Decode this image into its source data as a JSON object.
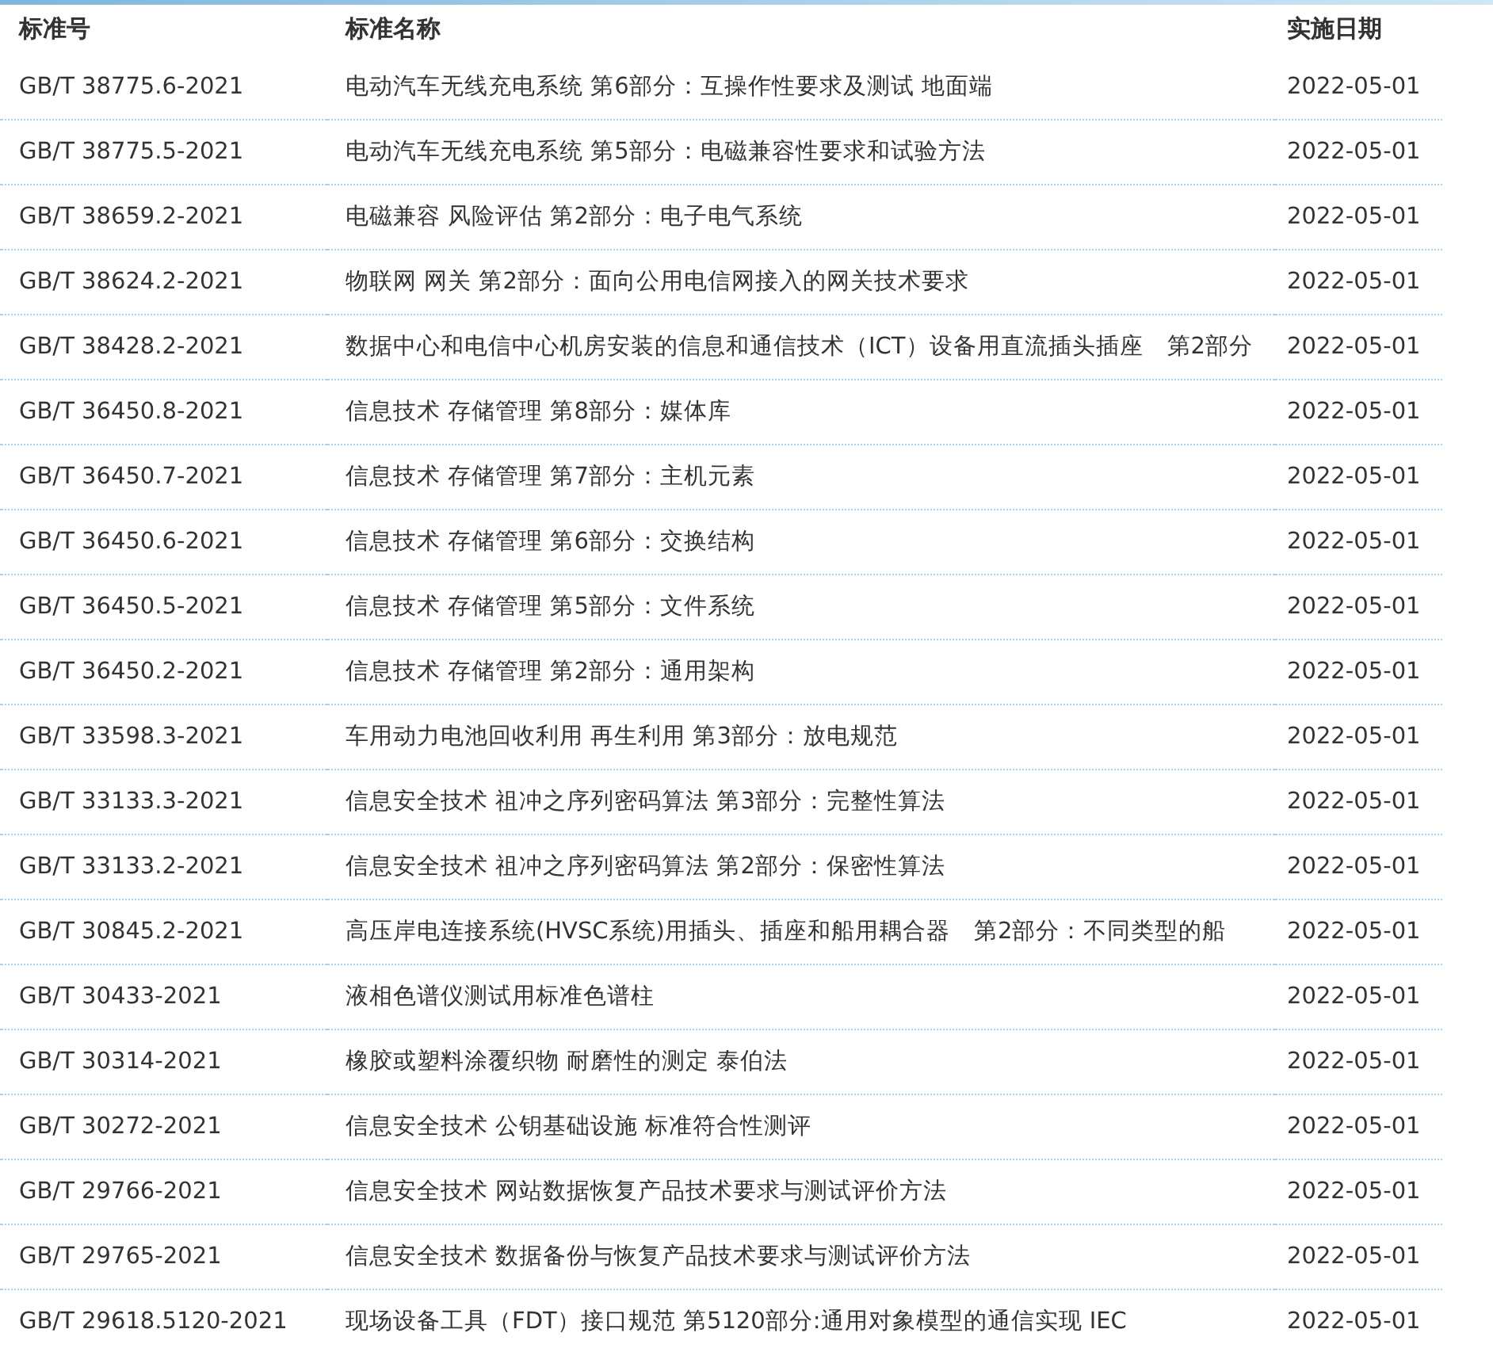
{
  "table": {
    "columns": [
      "标准号",
      "标准名称",
      "实施日期"
    ],
    "rows": [
      [
        "GB/T 38775.6-2021",
        "电动汽车无线充电系统 第6部分：互操作性要求及测试 地面端",
        "2022-05-01"
      ],
      [
        "GB/T 38775.5-2021",
        "电动汽车无线充电系统 第5部分：电磁兼容性要求和试验方法",
        "2022-05-01"
      ],
      [
        "GB/T 38659.2-2021",
        "电磁兼容 风险评估 第2部分：电子电气系统",
        "2022-05-01"
      ],
      [
        "GB/T 38624.2-2021",
        "物联网 网关 第2部分：面向公用电信网接入的网关技术要求",
        "2022-05-01"
      ],
      [
        "GB/T 38428.2-2021",
        "数据中心和电信中心机房安装的信息和通信技术（ICT）设备用直流插头插座　第2部分",
        "2022-05-01"
      ],
      [
        "GB/T 36450.8-2021",
        "信息技术 存储管理 第8部分：媒体库",
        "2022-05-01"
      ],
      [
        "GB/T 36450.7-2021",
        "信息技术 存储管理 第7部分：主机元素",
        "2022-05-01"
      ],
      [
        "GB/T 36450.6-2021",
        "信息技术 存储管理 第6部分：交换结构",
        "2022-05-01"
      ],
      [
        "GB/T 36450.5-2021",
        "信息技术 存储管理 第5部分：文件系统",
        "2022-05-01"
      ],
      [
        "GB/T 36450.2-2021",
        "信息技术 存储管理 第2部分：通用架构",
        "2022-05-01"
      ],
      [
        "GB/T 33598.3-2021",
        "车用动力电池回收利用 再生利用 第3部分：放电规范",
        "2022-05-01"
      ],
      [
        "GB/T 33133.3-2021",
        "信息安全技术 祖冲之序列密码算法 第3部分：完整性算法",
        "2022-05-01"
      ],
      [
        "GB/T 33133.2-2021",
        "信息安全技术 祖冲之序列密码算法 第2部分：保密性算法",
        "2022-05-01"
      ],
      [
        "GB/T 30845.2-2021",
        "高压岸电连接系统(HVSC系统)用插头、插座和船用耦合器　第2部分：不同类型的船",
        "2022-05-01"
      ],
      [
        "GB/T 30433-2021",
        "液相色谱仪测试用标准色谱柱",
        "2022-05-01"
      ],
      [
        "GB/T 30314-2021",
        "橡胶或塑料涂覆织物 耐磨性的测定 泰伯法",
        "2022-05-01"
      ],
      [
        "GB/T 30272-2021",
        "信息安全技术 公钥基础设施 标准符合性测评",
        "2022-05-01"
      ],
      [
        "GB/T 29766-2021",
        "信息安全技术 网站数据恢复产品技术要求与测试评价方法",
        "2022-05-01"
      ],
      [
        "GB/T 29765-2021",
        "信息安全技术 数据备份与恢复产品技术要求与测试评价方法",
        "2022-05-01"
      ],
      [
        "GB/T 29618.5120-2021",
        "现场设备工具（FDT）接口规范 第5120部分:通用对象模型的通信实现 IEC",
        "2022-05-01"
      ]
    ]
  }
}
